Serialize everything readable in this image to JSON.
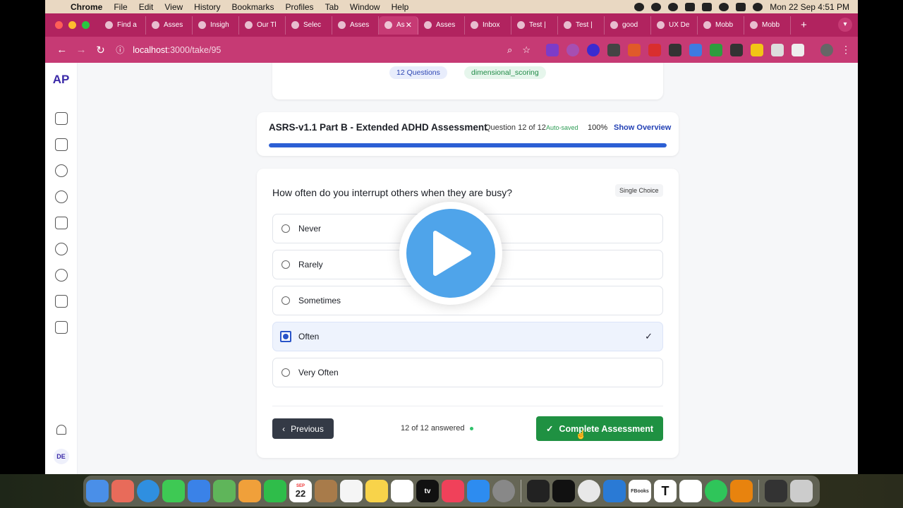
{
  "menubar": {
    "app": "Chrome",
    "items": [
      "File",
      "Edit",
      "View",
      "History",
      "Bookmarks",
      "Profiles",
      "Tab",
      "Window",
      "Help"
    ],
    "clock": "Mon 22 Sep  4:51 PM"
  },
  "tabs": [
    {
      "label": "Find a"
    },
    {
      "label": "Asses"
    },
    {
      "label": "Insigh"
    },
    {
      "label": "Our Tl"
    },
    {
      "label": "Selec"
    },
    {
      "label": "Asses"
    },
    {
      "label": "As",
      "active": true
    },
    {
      "label": "Asses"
    },
    {
      "label": "Inbox"
    },
    {
      "label": "Test |"
    },
    {
      "label": "Test |"
    },
    {
      "label": "good"
    },
    {
      "label": "UX De"
    },
    {
      "label": "Mobb"
    },
    {
      "label": "Mobb"
    }
  ],
  "browser": {
    "url_host": "localhost",
    "url_path": ":3000/take/95"
  },
  "app": {
    "logo": "AP",
    "avatar_initials": "DE",
    "nav_icons": [
      "home-icon",
      "document-icon",
      "globe-icon",
      "plus-circle-icon",
      "bar-chart-icon",
      "chart-pie-icon",
      "users-icon",
      "clipboard-icon",
      "building-icon"
    ]
  },
  "summary": {
    "questions_chip": "12 Questions",
    "scoring_chip": "dimensional_scoring"
  },
  "assessment": {
    "title": "ASRS-v1.1 Part B - Extended ADHD Assessment",
    "question_of": "Question 12 of 12",
    "autosave": "Auto-saved",
    "percent": "100%",
    "progress": 1.0,
    "show_overview": "Show Overview"
  },
  "question": {
    "text": "How often do you interrupt others when they are busy?",
    "type": "Single Choice",
    "options": [
      {
        "label": "Never",
        "selected": false
      },
      {
        "label": "Rarely",
        "selected": false
      },
      {
        "label": "Sometimes",
        "selected": false
      },
      {
        "label": "Often",
        "selected": true
      },
      {
        "label": "Very Often",
        "selected": false
      }
    ]
  },
  "footer": {
    "previous": "Previous",
    "answered": "12 of 12 answered",
    "complete": "Complete Assessment"
  },
  "dock": {
    "calendar_month": "SEP",
    "calendar_day": "22",
    "appletv_label": "tv",
    "books_label": "FBooks",
    "text_label": "T"
  },
  "colors": {
    "accent": "#c63a74",
    "primary": "#2c5fd4",
    "success": "#1f9142"
  }
}
